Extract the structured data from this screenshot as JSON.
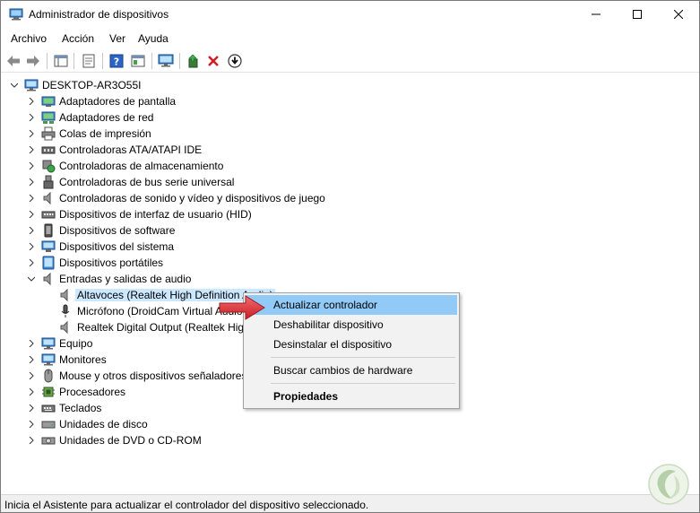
{
  "window": {
    "title": "Administrador de dispositivos"
  },
  "menu": [
    "Archivo",
    "Acción",
    "Ver",
    "Ayuda"
  ],
  "tree": {
    "root": "DESKTOP-AR3O55I",
    "categories": [
      {
        "label": "Adaptadores de pantalla",
        "icon": "display-adapter-icon"
      },
      {
        "label": "Adaptadores de red",
        "icon": "network-adapter-icon"
      },
      {
        "label": "Colas de impresión",
        "icon": "printer-icon"
      },
      {
        "label": "Controladoras ATA/ATAPI IDE",
        "icon": "ide-controller-icon"
      },
      {
        "label": "Controladoras de almacenamiento",
        "icon": "storage-controller-icon"
      },
      {
        "label": "Controladoras de bus serie universal",
        "icon": "usb-icon"
      },
      {
        "label": "Controladoras de sonido y vídeo y dispositivos de juego",
        "icon": "speaker-icon"
      },
      {
        "label": "Dispositivos de interfaz de usuario (HID)",
        "icon": "hid-icon"
      },
      {
        "label": "Dispositivos de software",
        "icon": "software-device-icon"
      },
      {
        "label": "Dispositivos del sistema",
        "icon": "system-device-icon"
      },
      {
        "label": "Dispositivos portátiles",
        "icon": "portable-device-icon"
      },
      {
        "label": "Entradas y salidas de audio",
        "icon": "audio-io-icon"
      }
    ],
    "audio_children": [
      {
        "label": "Altavoces (Realtek High Definition Audio)",
        "icon": "speaker-icon"
      },
      {
        "label": "Micrófono (DroidCam Virtual Audio)",
        "icon": "microphone-icon"
      },
      {
        "label": "Realtek Digital Output (Realtek High Definition Audio)",
        "icon": "speaker-icon"
      }
    ],
    "categories_after": [
      {
        "label": "Equipo",
        "icon": "computer-icon"
      },
      {
        "label": "Monitores",
        "icon": "monitor-icon"
      },
      {
        "label": "Mouse y otros dispositivos señaladores",
        "icon": "mouse-icon"
      },
      {
        "label": "Procesadores",
        "icon": "processor-icon"
      },
      {
        "label": "Teclados",
        "icon": "keyboard-icon"
      },
      {
        "label": "Unidades de disco",
        "icon": "disk-drive-icon"
      },
      {
        "label": "Unidades de DVD o CD-ROM",
        "icon": "dvd-drive-icon"
      }
    ]
  },
  "context_menu": {
    "update": "Actualizar controlador",
    "disable": "Deshabilitar dispositivo",
    "uninstall": "Desinstalar el dispositivo",
    "scan": "Buscar cambios de hardware",
    "properties": "Propiedades"
  },
  "status": "Inicia el Asistente para actualizar el controlador del dispositivo seleccionado.",
  "colors": {
    "selection": "#cce8ff",
    "menu_highlight": "#91c9f7",
    "arrow": "#e0343a"
  }
}
